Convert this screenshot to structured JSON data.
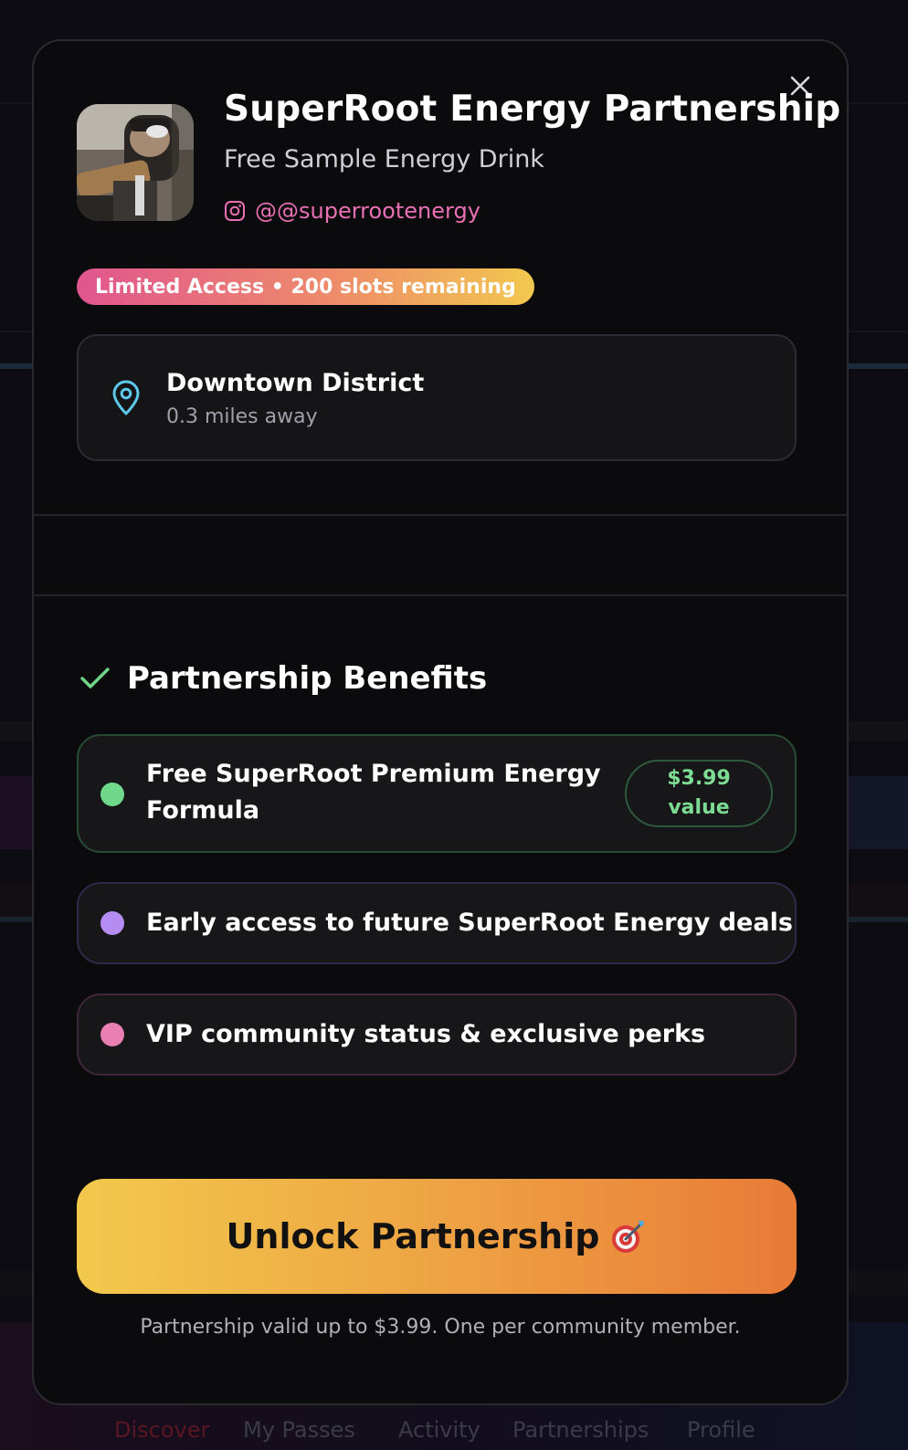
{
  "background_nav": {
    "items": [
      {
        "label": "Discover",
        "active": true
      },
      {
        "label": "My Passes",
        "active": false
      },
      {
        "label": "Activity",
        "active": false
      },
      {
        "label": "Partnerships",
        "active": false
      },
      {
        "label": "Profile",
        "active": false
      }
    ]
  },
  "modal": {
    "title": "SuperRoot Energy Partnership",
    "subtitle": "Free Sample Energy Drink",
    "handle": "@@superrootenergy",
    "handle_icon": "instagram-icon",
    "badge": "Limited Access • 200 slots remaining",
    "location": {
      "name": "Downtown District",
      "distance": "0.3 miles away",
      "icon": "map-pin-icon"
    },
    "benefits_title": "Partnership Benefits",
    "benefits": [
      {
        "text": "Free SuperRoot Premium Energy Formula",
        "value_amount": "$3.99",
        "value_label": "value",
        "dot_color": "#6fd88a"
      },
      {
        "text": "Early access to future SuperRoot Energy deals",
        "dot_color": "#b58cf2"
      },
      {
        "text": "VIP community status & exclusive perks",
        "dot_color": "#ea7fb4"
      }
    ],
    "cta_label": "Unlock Partnership",
    "cta_icon": "target-icon",
    "footnote": "Partnership valid up to $3.99. One per community member."
  },
  "colors": {
    "accent_pink": "#e870b4",
    "accent_green": "#6fd88a",
    "cta_gradient_start": "#f2c94c",
    "cta_gradient_end": "#e87a36"
  }
}
